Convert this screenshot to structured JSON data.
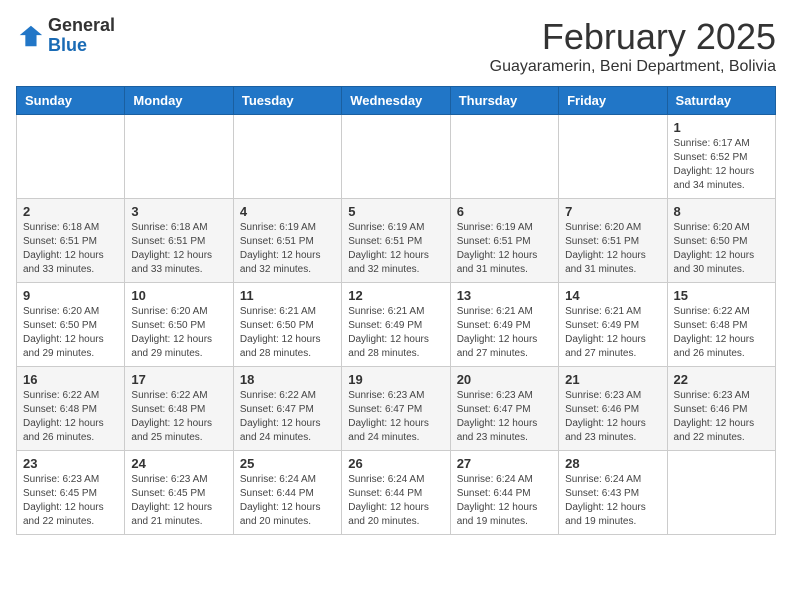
{
  "logo": {
    "line1": "General",
    "line2": "Blue"
  },
  "title": "February 2025",
  "subtitle": "Guayaramerin, Beni Department, Bolivia",
  "days_of_week": [
    "Sunday",
    "Monday",
    "Tuesday",
    "Wednesday",
    "Thursday",
    "Friday",
    "Saturday"
  ],
  "weeks": [
    [
      {
        "day": "",
        "info": ""
      },
      {
        "day": "",
        "info": ""
      },
      {
        "day": "",
        "info": ""
      },
      {
        "day": "",
        "info": ""
      },
      {
        "day": "",
        "info": ""
      },
      {
        "day": "",
        "info": ""
      },
      {
        "day": "1",
        "info": "Sunrise: 6:17 AM\nSunset: 6:52 PM\nDaylight: 12 hours and 34 minutes."
      }
    ],
    [
      {
        "day": "2",
        "info": "Sunrise: 6:18 AM\nSunset: 6:51 PM\nDaylight: 12 hours and 33 minutes."
      },
      {
        "day": "3",
        "info": "Sunrise: 6:18 AM\nSunset: 6:51 PM\nDaylight: 12 hours and 33 minutes."
      },
      {
        "day": "4",
        "info": "Sunrise: 6:19 AM\nSunset: 6:51 PM\nDaylight: 12 hours and 32 minutes."
      },
      {
        "day": "5",
        "info": "Sunrise: 6:19 AM\nSunset: 6:51 PM\nDaylight: 12 hours and 32 minutes."
      },
      {
        "day": "6",
        "info": "Sunrise: 6:19 AM\nSunset: 6:51 PM\nDaylight: 12 hours and 31 minutes."
      },
      {
        "day": "7",
        "info": "Sunrise: 6:20 AM\nSunset: 6:51 PM\nDaylight: 12 hours and 31 minutes."
      },
      {
        "day": "8",
        "info": "Sunrise: 6:20 AM\nSunset: 6:50 PM\nDaylight: 12 hours and 30 minutes."
      }
    ],
    [
      {
        "day": "9",
        "info": "Sunrise: 6:20 AM\nSunset: 6:50 PM\nDaylight: 12 hours and 29 minutes."
      },
      {
        "day": "10",
        "info": "Sunrise: 6:20 AM\nSunset: 6:50 PM\nDaylight: 12 hours and 29 minutes."
      },
      {
        "day": "11",
        "info": "Sunrise: 6:21 AM\nSunset: 6:50 PM\nDaylight: 12 hours and 28 minutes."
      },
      {
        "day": "12",
        "info": "Sunrise: 6:21 AM\nSunset: 6:49 PM\nDaylight: 12 hours and 28 minutes."
      },
      {
        "day": "13",
        "info": "Sunrise: 6:21 AM\nSunset: 6:49 PM\nDaylight: 12 hours and 27 minutes."
      },
      {
        "day": "14",
        "info": "Sunrise: 6:21 AM\nSunset: 6:49 PM\nDaylight: 12 hours and 27 minutes."
      },
      {
        "day": "15",
        "info": "Sunrise: 6:22 AM\nSunset: 6:48 PM\nDaylight: 12 hours and 26 minutes."
      }
    ],
    [
      {
        "day": "16",
        "info": "Sunrise: 6:22 AM\nSunset: 6:48 PM\nDaylight: 12 hours and 26 minutes."
      },
      {
        "day": "17",
        "info": "Sunrise: 6:22 AM\nSunset: 6:48 PM\nDaylight: 12 hours and 25 minutes."
      },
      {
        "day": "18",
        "info": "Sunrise: 6:22 AM\nSunset: 6:47 PM\nDaylight: 12 hours and 24 minutes."
      },
      {
        "day": "19",
        "info": "Sunrise: 6:23 AM\nSunset: 6:47 PM\nDaylight: 12 hours and 24 minutes."
      },
      {
        "day": "20",
        "info": "Sunrise: 6:23 AM\nSunset: 6:47 PM\nDaylight: 12 hours and 23 minutes."
      },
      {
        "day": "21",
        "info": "Sunrise: 6:23 AM\nSunset: 6:46 PM\nDaylight: 12 hours and 23 minutes."
      },
      {
        "day": "22",
        "info": "Sunrise: 6:23 AM\nSunset: 6:46 PM\nDaylight: 12 hours and 22 minutes."
      }
    ],
    [
      {
        "day": "23",
        "info": "Sunrise: 6:23 AM\nSunset: 6:45 PM\nDaylight: 12 hours and 22 minutes."
      },
      {
        "day": "24",
        "info": "Sunrise: 6:23 AM\nSunset: 6:45 PM\nDaylight: 12 hours and 21 minutes."
      },
      {
        "day": "25",
        "info": "Sunrise: 6:24 AM\nSunset: 6:44 PM\nDaylight: 12 hours and 20 minutes."
      },
      {
        "day": "26",
        "info": "Sunrise: 6:24 AM\nSunset: 6:44 PM\nDaylight: 12 hours and 20 minutes."
      },
      {
        "day": "27",
        "info": "Sunrise: 6:24 AM\nSunset: 6:44 PM\nDaylight: 12 hours and 19 minutes."
      },
      {
        "day": "28",
        "info": "Sunrise: 6:24 AM\nSunset: 6:43 PM\nDaylight: 12 hours and 19 minutes."
      },
      {
        "day": "",
        "info": ""
      }
    ]
  ]
}
